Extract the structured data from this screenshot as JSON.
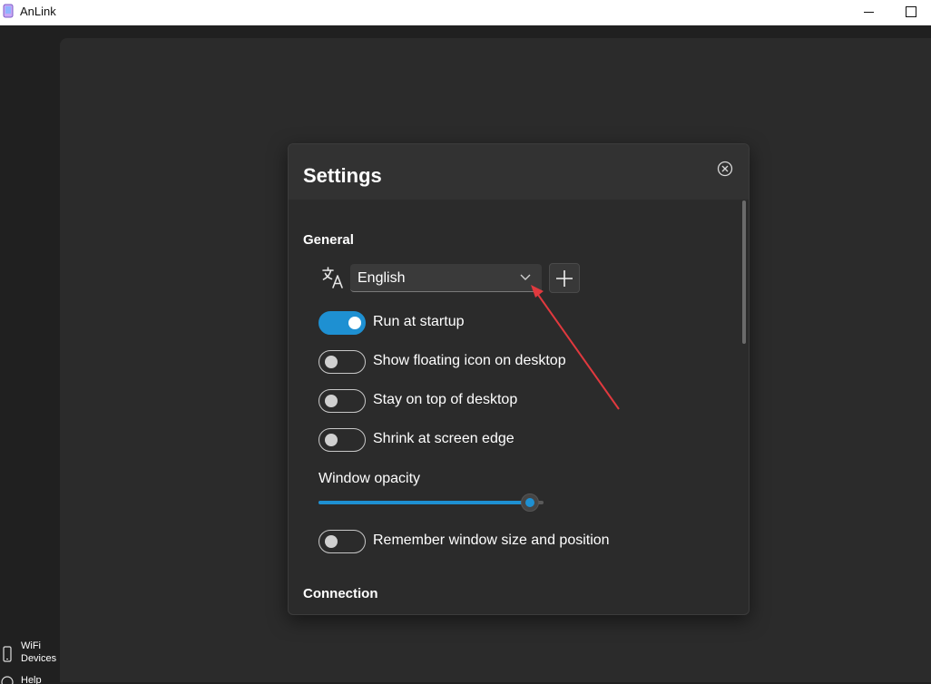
{
  "window": {
    "title": "AnLink"
  },
  "sidebar": {
    "wifi_devices_label": "WiFi Devices",
    "help_label": "Help"
  },
  "settings": {
    "title": "Settings",
    "general_heading": "General",
    "language": {
      "selected": "English",
      "icon": "translate-icon"
    },
    "toggles": [
      {
        "label": "Run at startup",
        "on": true
      },
      {
        "label": "Show floating icon on desktop",
        "on": false
      },
      {
        "label": "Stay on top of desktop",
        "on": false
      },
      {
        "label": "Shrink at screen edge",
        "on": false
      }
    ],
    "opacity": {
      "label": "Window opacity",
      "value": 0.94
    },
    "remember_toggle": {
      "label": "Remember window size and position",
      "on": false
    },
    "connection_heading": "Connection"
  },
  "colors": {
    "accent": "#1e90d2",
    "annotation_arrow": "#e0393e"
  }
}
